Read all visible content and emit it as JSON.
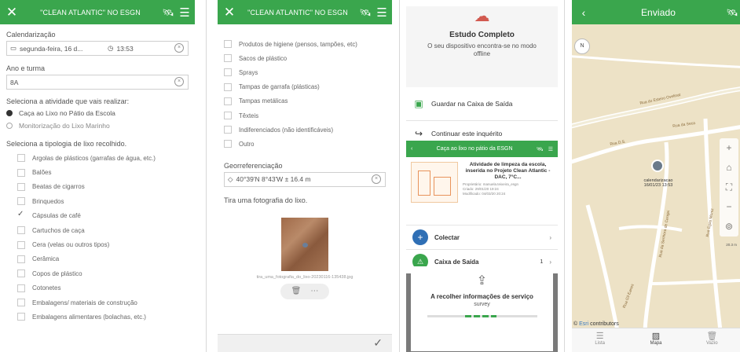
{
  "panel1": {
    "header_title": "\"CLEAN ATLANTIC\" NO ESGN",
    "scheduling_label": "Calendarização",
    "date_value": "segunda-feira, 16 d...",
    "time_value": "13:53",
    "year_class_label": "Ano e turma",
    "year_class_value": "8A",
    "activity_question": "Seleciona a atividade que vais realizar:",
    "activity_options": [
      {
        "label": "Caça ao Lixo no Pátio da Escola",
        "selected": true
      },
      {
        "label": "Monitorização do Lixo Marinho",
        "selected": false
      }
    ],
    "litter_question": "Seleciona a tipologia de lixo recolhido.",
    "litter_options": [
      {
        "label": "Argolas de plásticos (garrafas de água, etc.)",
        "checked": false
      },
      {
        "label": "Balões",
        "checked": false
      },
      {
        "label": "Beatas de cigarros",
        "checked": false
      },
      {
        "label": "Brinquedos",
        "checked": false
      },
      {
        "label": "Cápsulas de café",
        "checked": true
      },
      {
        "label": "Cartuchos de caça",
        "checked": false
      },
      {
        "label": "Cera (velas ou outros tipos)",
        "checked": false
      },
      {
        "label": "Cerâmica",
        "checked": false
      },
      {
        "label": "Copos de plástico",
        "checked": false
      },
      {
        "label": "Cotonetes",
        "checked": false
      },
      {
        "label": "Embalagens/ materiais de construção",
        "checked": false
      },
      {
        "label": "Embalagens alimentares (bolachas, etc.)",
        "checked": false
      }
    ]
  },
  "panel2": {
    "header_title": "\"CLEAN ATLANTIC\" NO ESGN",
    "litter_options": [
      {
        "label": "Produtos de higiene (pensos, tampões, etc)"
      },
      {
        "label": "Sacos de plástico"
      },
      {
        "label": "Sprays"
      },
      {
        "label": "Tampas de garrafa (plásticas)"
      },
      {
        "label": "Tampas metálicas"
      },
      {
        "label": "Têxteis"
      },
      {
        "label": "Indiferenciados (não identificáveis)"
      },
      {
        "label": "Outro"
      }
    ],
    "georef_label": "Georreferenciação",
    "georef_value": "40°39'N 8°43'W ± 16.4 m",
    "photo_label": "Tira uma fotografia do lixo.",
    "photo_filename": "tira_uma_fotografia_do_lixo-20230116-135438.jpg"
  },
  "panel3": {
    "status_title": "Estudo Completo",
    "status_subtitle": "O seu dispositivo encontra-se no modo offline",
    "save_outbox": "Guardar na Caixa de Saída",
    "continue_survey": "Continuar este inquérito",
    "card_header_title": "Caça ao lixo no pátio da ESGN",
    "survey_title": "Atividade de limpeza da escola, inserida no Projeto Clean Atlantic - DAC, 7°C...",
    "survey_owner": "Proprietário: manuela.teixeira_esgn",
    "survey_created": "Criado: 29/01/20 19:24",
    "survey_modified": "Modificado: 04/03/20 20:24",
    "collect_label": "Colectar",
    "outbox_label": "Caixa de Saída",
    "outbox_count": "1",
    "modal_title": "A recolher informações de serviço",
    "modal_subtitle": "survey"
  },
  "panel4": {
    "header_title": "Enviado",
    "compass": "N",
    "pin_label": "calendarizacao\n16/01/23 13:53",
    "attribution_brand": "Esri",
    "attribution_text": "contributors",
    "scale": "20.3 m",
    "streets": [
      "Rua do Esteiro Ovelinat",
      "Rua da Seca",
      "Rua da Senhora de Cerejei",
      "Rua de Maria",
      "Rua dos Conde",
      "Rua D.S.",
      "Rua Gil Eanes",
      "Rua Egas Moniz",
      "Rua de Gil Eanes",
      "Rua de Fonte"
    ],
    "tabs": [
      {
        "label": "Lista",
        "icon": "list-icon",
        "active": false
      },
      {
        "label": "Mapa",
        "icon": "map-icon",
        "active": true
      },
      {
        "label": "Vazio",
        "icon": "trash-icon",
        "active": false
      }
    ]
  },
  "colors": {
    "accent_green": "#3aa64d",
    "map_bg": "#ede2c6",
    "alert_red": "#d25a50",
    "collect_blue": "#2f6fb5"
  }
}
